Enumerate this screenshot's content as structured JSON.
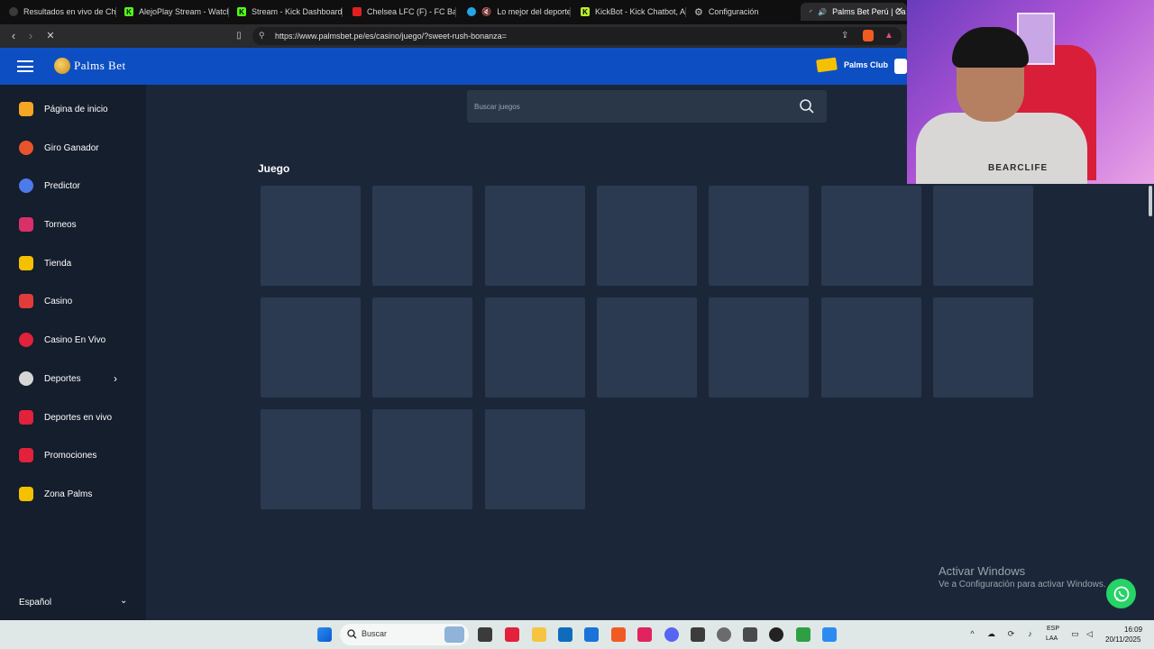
{
  "browser": {
    "tabs": [
      {
        "label": "Resultados en vivo de Cha",
        "favicon_color": "#3a3a3a"
      },
      {
        "label": "AlejoPlay Stream - Watch",
        "favicon_color": "#53fc18"
      },
      {
        "label": "Stream - Kick Dashboard",
        "favicon_color": "#53fc18"
      },
      {
        "label": "Chelsea LFC (F) - FC Barce",
        "favicon_color": "#e02020"
      },
      {
        "label": "Lo mejor del deporte",
        "favicon_color": "#23a6e6"
      },
      {
        "label": "KickBot - Kick Chatbot, Ale",
        "favicon_color": "#b9f12a"
      },
      {
        "label": "Configuración",
        "favicon_color": "#bbbbbb"
      },
      {
        "label": "Palms Bet Perú | Ca",
        "favicon_color": "#bbbbbb"
      }
    ],
    "url": "https://www.palmsbet.pe/es/casino/juego/?sweet-rush-bonanza="
  },
  "header": {
    "logo_text": "Palms Bet",
    "palms_club_label": "Palms Club"
  },
  "sidebar": {
    "items": [
      {
        "label": "Página de inicio",
        "icon": "home-icon",
        "color": "#f6a623"
      },
      {
        "label": "Giro Ganador",
        "icon": "wheel-icon",
        "color": "#e8532b"
      },
      {
        "label": "Predictor",
        "icon": "soccer-ball-icon",
        "color": "#4d7bea"
      },
      {
        "label": "Torneos",
        "icon": "trophy-icon",
        "color": "#d9306a"
      },
      {
        "label": "Tienda",
        "icon": "cart-icon",
        "color": "#f5c000"
      },
      {
        "label": "Casino",
        "icon": "slot-machine-icon",
        "color": "#e23b3b"
      },
      {
        "label": "Casino En Vivo",
        "icon": "roulette-icon",
        "color": "#e2213b"
      },
      {
        "label": "Deportes",
        "icon": "football-icon",
        "color": "#d6d6d6"
      },
      {
        "label": "Deportes en vivo",
        "icon": "live-icon",
        "color": "#e2213b"
      },
      {
        "label": "Promociones",
        "icon": "gift-icon",
        "color": "#e2213b"
      },
      {
        "label": "Zona Palms",
        "icon": "party-icon",
        "color": "#f5c000"
      }
    ],
    "language": "Español"
  },
  "main": {
    "search_placeholder": "Buscar juegos",
    "section_title": "Juego",
    "placeholder_card_count": 17
  },
  "webcam": {
    "shirt_text": "BEARCLIFE"
  },
  "watermark": {
    "line1": "Activar Windows",
    "line2": "Ve a Configuración para activar Windows."
  },
  "taskbar": {
    "search_label": "Buscar",
    "lang_line1": "ESP",
    "lang_line2": "LAA",
    "time": "16:09",
    "date": "20/11/2025"
  },
  "colors": {
    "header_blue": "#0d4fc2",
    "page_bg": "#1b2738",
    "sidebar_bg": "#141e2c",
    "card_bg": "#2b3a50",
    "whatsapp_green": "#25d366"
  }
}
